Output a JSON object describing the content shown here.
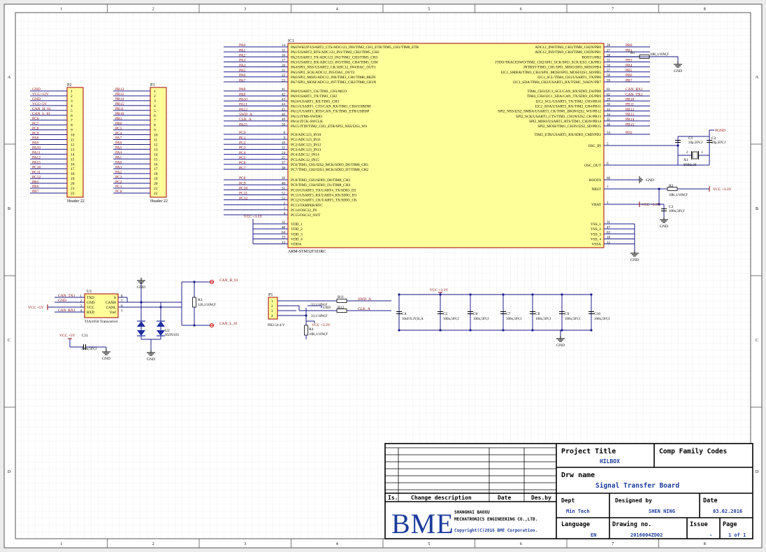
{
  "colors": {
    "wire": "#1c1c8c",
    "label": "#8b0000",
    "chipFill": "#ffff99",
    "chipBorder": "#a00000",
    "pin": "#8b0000",
    "grid": "#dcdcdc",
    "logo": "#1c3c9c",
    "sheetBg": "#ffffff"
  },
  "border": {
    "cols": [
      "1",
      "2",
      "3",
      "4",
      "5",
      "6",
      "7",
      "8"
    ],
    "rows": [
      "A",
      "B",
      "C",
      "D"
    ]
  },
  "p2": {
    "ref": "P2",
    "name": "Header 22",
    "nets": [
      "GND",
      "VCC+12V",
      "GND",
      "VCC+5V",
      "CAN_H_01",
      "CAN_L_01",
      "PC6",
      "PC7",
      "PC8",
      "PC9",
      "PA8",
      "PA9",
      "PA10",
      "PA11",
      "PA12",
      "PA15",
      "PC10",
      "PC11",
      "PC12",
      "PB5",
      "PB6",
      "PB7"
    ],
    "pins": [
      "1",
      "2",
      "3",
      "4",
      "5",
      "6",
      "7",
      "8",
      "9",
      "10",
      "11",
      "12",
      "13",
      "14",
      "15",
      "16",
      "17",
      "18",
      "19",
      "20",
      "21",
      "22"
    ]
  },
  "p3": {
    "ref": "P3",
    "name": "Header 22",
    "nets": [
      "PB13",
      "PB12",
      "PB14",
      "PB15",
      "PB11",
      "PB10",
      "PB1",
      "PB0",
      "PC5",
      "PC4",
      "PA7",
      "PA6",
      "PA5",
      "PA4",
      "PA1",
      "PA0",
      "PA3",
      "PA2",
      "PC3",
      "PC2",
      "PC1",
      "PC0"
    ],
    "pins": [
      "1",
      "2",
      "3",
      "4",
      "5",
      "6",
      "7",
      "8",
      "9",
      "10",
      "11",
      "12",
      "13",
      "14",
      "15",
      "16",
      "17",
      "18",
      "19",
      "20",
      "21",
      "22"
    ]
  },
  "ic1": {
    "ref": "IC1",
    "name": "ARM-STM32F103RC",
    "left1": [
      {
        "net": "PA0",
        "pin": "14",
        "fn": "PA0/WKUP/USART2_CTS/ADC123_IN0/TIM2_CH1_ETR/TIM5_CH1/TIM8_ETR"
      },
      {
        "net": "PA1",
        "pin": "15",
        "fn": "PA1/USART2_RTS/ADC123_IN1/TIM2_CH2/TIM5_CH2"
      },
      {
        "net": "PA2",
        "pin": "16",
        "fn": "PA2/USART2_TX/ADC123_IN2/TIM2_CH3/TIM5_CH3"
      },
      {
        "net": "PA3",
        "pin": "17",
        "fn": "PA3/USART2_RX/ADC123_IN3/TIM2_CH4/TIM5_CH4"
      },
      {
        "net": "PA4",
        "pin": "20",
        "fn": "PA4/SPI1_NSS/USART2_CK/ADC12_IN4/DAC_OUT1"
      },
      {
        "net": "PA5",
        "pin": "21",
        "fn": "PA5/SPI1_SCK/ADC12_IN5/DAC_OUT2"
      },
      {
        "net": "PA6",
        "pin": "22",
        "fn": "PA6/SPI1_MISO/ADC12_IN6/TIM3_CH1/TIM8_BKIN"
      },
      {
        "net": "PA7",
        "pin": "23",
        "fn": "PA7/SPI1_MOSI/ADC12_IN7/TIM3_CH2/TIM8_CH1N"
      }
    ],
    "left2": [
      {
        "net": "PA8",
        "pin": "41",
        "fn": "PA8/USART1_CK/TIM1_CH1/MCO"
      },
      {
        "net": "PA9",
        "pin": "42",
        "fn": "PA9/USART1_TX/TIM1_CH2"
      },
      {
        "net": "PA10",
        "pin": "43",
        "fn": "PA10/USART1_RX/TIM1_CH3"
      },
      {
        "net": "PA11",
        "pin": "44",
        "fn": "PA11/USART1_CTS/CAN_RX/TIM1_CH4/USBDM"
      },
      {
        "net": "PA12",
        "pin": "45",
        "fn": "PA12/USART1_RTS/CAN_TX/TIM1_ETR/USBDP"
      },
      {
        "net": "SWD_A",
        "pin": "46",
        "fn": "PA13/JTMS-SWDIO"
      },
      {
        "net": "CLK_A",
        "pin": "49",
        "fn": "PA14/JTCK-SWCLK"
      },
      {
        "net": "PA15",
        "pin": "50",
        "fn": "PA15/JTDI/TIM2_CH1_ETR/SPI3_NSS/I2S3_WS"
      }
    ],
    "left3": [
      {
        "net": "PC0",
        "pin": "8",
        "fn": "PC0/ADC123_IN10"
      },
      {
        "net": "PC1",
        "pin": "9",
        "fn": "PC1/ADC123_IN11"
      },
      {
        "net": "PC2",
        "pin": "10",
        "fn": "PC2/ADC123_IN12"
      },
      {
        "net": "PC3",
        "pin": "11",
        "fn": "PC3/ADC123_IN13"
      },
      {
        "net": "PC4",
        "pin": "24",
        "fn": "PC4/ADC12_IN14"
      },
      {
        "net": "PC5",
        "pin": "25",
        "fn": "PC5/ADC12_IN15"
      },
      {
        "net": "PC6",
        "pin": "37",
        "fn": "PC6/TIM3_CH1/I2S2_MCK/SDIO_D6/TIM8_CH1"
      },
      {
        "net": "PC7",
        "pin": "38",
        "fn": "PC7/TIM3_CH2/I2S3_MCK/SDIO_D7/TIM8_CH2"
      }
    ],
    "left4": [
      {
        "net": "PC8",
        "pin": "39",
        "fn": "PC8/TIM3_CH3/SDIO_D0/TIM8_CH3"
      },
      {
        "net": "PC9",
        "pin": "40",
        "fn": "PC9/TIM3_CH4/SDIO_D1/TIM8_CH4"
      },
      {
        "net": "PC10",
        "pin": "51",
        "fn": "PC10/USART3_TX/UART4_TX/SDIO_D2"
      },
      {
        "net": "PC11",
        "pin": "52",
        "fn": "PC11/USART3_RX/UART4_RX/SDIO_D3"
      },
      {
        "net": "PC12",
        "pin": "53",
        "fn": "PC12/USART3_CK/UART5_TX/SDIO_CK"
      },
      {
        "net": "",
        "pin": "2",
        "fn": "PC13/TAMPER/RTC"
      },
      {
        "net": "",
        "pin": "3",
        "fn": "PC14/OSC32_IN"
      },
      {
        "net": "",
        "pin": "4",
        "fn": "PC15/OSC32_OUT"
      }
    ],
    "left5": [
      {
        "pin": "32",
        "fn": "VDD_1"
      },
      {
        "pin": "48",
        "fn": "VDD_2"
      },
      {
        "pin": "64",
        "fn": "VDD_3"
      },
      {
        "pin": "19",
        "fn": "VDD_4"
      },
      {
        "pin": "13",
        "fn": "VDDA"
      }
    ],
    "vccLeft": "VCC +3.3V",
    "right1": [
      {
        "net": "PB0",
        "pin": "26",
        "fn": "ADC12_IN8/TIM3_CH3/TIM8_CH2N/PB0"
      },
      {
        "net": "PB1",
        "pin": "27",
        "fn": "ADC12_IN9/TIM3_CH4/TIM8_CH3N/PB1"
      },
      {
        "net": "",
        "pin": "28",
        "fn": "BOOT1/PB2"
      },
      {
        "net": "PB3",
        "pin": "55",
        "fn": "JTDO/TRACESWO/TIM2_CH2/SPI1_SCK/SPI3_SCK/I2S3_CK/PB3"
      },
      {
        "net": "PB4",
        "pin": "56",
        "fn": "JNTRST/TIM3_CH1/SPI1_MISO/SPI3_MISO/PB4"
      },
      {
        "net": "PB5",
        "pin": "57",
        "fn": "I2C1_SMBAI/TIM3_CH2/SPI1_MOSI/SPI3_MOSI/I2S3_SD/PB5"
      },
      {
        "net": "PB6",
        "pin": "58",
        "fn": "I2C1_SCL/TIM4_CH1/USART1_TX/PB6"
      },
      {
        "net": "PB7",
        "pin": "59",
        "fn": "I2C1_SDA/TIM4_CH2/USART1_RX/TSMC_NADV/PB7"
      }
    ],
    "right2": [
      {
        "net": "CAN_RX1",
        "pin": "61",
        "fn": "TIM4_CH3/I2C1_SCL/CAN_RX/SDIO_D4/PB8"
      },
      {
        "net": "CAN_TX1",
        "pin": "62",
        "fn": "TIM4_CH4/I2C1_SDA/CAN_TX/SDIO_D5/PB9"
      },
      {
        "net": "PB10",
        "pin": "29",
        "fn": "I2C2_SCL/USART3_TX/TIM2_CH3/PB10"
      },
      {
        "net": "PB11",
        "pin": "30",
        "fn": "I2C2_SDA/USART3_RX/TIM2_CH4/PB11"
      },
      {
        "net": "PB12",
        "pin": "33",
        "fn": "SPI2_NSS/I2S2_SMBA/USART3_CK/TIM1_BKIN/I2S2_WS/PB12"
      },
      {
        "net": "PB13",
        "pin": "34",
        "fn": "SPI2_SCK/USART3_CTS/TIM1_CH1N/I2S2_CK/PB13"
      },
      {
        "net": "PB14",
        "pin": "35",
        "fn": "SPI2_MISO/USART3_RTS/TIM1_CH2N/PB14"
      },
      {
        "net": "PB15",
        "pin": "36",
        "fn": "SPI2_MOSI/TIM1_CH3N/I2S2_SD/PB15"
      }
    ],
    "pd2": {
      "net": "PD2",
      "pin": "54",
      "fn": "TIM3_ETR/USART5_RX/SDIO_CMD/PD2"
    },
    "osc_in": {
      "pin": "5",
      "fn": "OSC_IN"
    },
    "osc_out": {
      "pin": "6",
      "fn": "OSC_OUT"
    },
    "boot0": {
      "pin": "60",
      "fn": "BOOT0"
    },
    "nrst": {
      "pin": "7",
      "fn": "NRST"
    },
    "vbat": {
      "pin": "1",
      "fn": "VBAT"
    },
    "vss": [
      {
        "pin": "31",
        "fn": "VSS_1"
      },
      {
        "pin": "47",
        "fn": "VSS_2"
      },
      {
        "pin": "63",
        "fn": "VSS_3"
      },
      {
        "pin": "18",
        "fn": "VSS_4"
      },
      {
        "pin": "12",
        "fn": "VSSA"
      }
    ]
  },
  "r1": {
    "ref": "R1",
    "val": "10K,1/10W,F"
  },
  "r2": {
    "ref": "R2",
    "val": "10K,1/10W,F"
  },
  "c1": {
    "ref": "C1",
    "val": "20p,50V,J"
  },
  "c2": {
    "ref": "C2",
    "val": "20p,50V,J"
  },
  "c3": {
    "ref": "C3",
    "val": "100n,50V,J"
  },
  "x1": {
    "ref": "X1",
    "val": "8MHz,M",
    "pin1": "1",
    "pin2": "2"
  },
  "vcc33": "VCC +3.3V",
  "gnd": "GND",
  "pgnd": "PGND",
  "u1": {
    "ref": "U1",
    "name": "TJA1050 Transceiver",
    "lpins": [
      "TXD",
      "GND",
      "VCC",
      "RXD"
    ],
    "rpins": [
      "S",
      "CANH",
      "CANL",
      "Vref"
    ],
    "lnums": [
      "1",
      "2",
      "3",
      "4"
    ],
    "rnums": [
      "8",
      "7",
      "6",
      "5"
    ],
    "nets": [
      "CAN_TX1",
      "GND",
      "",
      "CAN_RX1"
    ],
    "vcc": "VCC +5V"
  },
  "r3": {
    "ref": "R3",
    "val": "120,1/10W,F"
  },
  "u2": {
    "ref": "U2",
    "val": "NUP2105"
  },
  "can_h": "CAN_H_01",
  "can_l": "CAN_L_01",
  "c11": {
    "ref": "C11",
    "val": "100n,50V,J",
    "vcc": "VCC +5V"
  },
  "p1": {
    "ref": "P1",
    "name": "PH2.54-4-V",
    "pins": [
      "1",
      "2",
      "3",
      "4"
    ]
  },
  "r11": {
    "ref": "R11",
    "val": "33,1/10W,F"
  },
  "r12": {
    "ref": "R12",
    "val": "33,1/10W,F"
  },
  "r4": {
    "ref": "R4",
    "val": "10K,1/10W,F"
  },
  "swd": "SWD_A",
  "clk": "CLK_A",
  "caps": [
    {
      "ref": "C4",
      "val": "10uF/6.3V,K,A"
    },
    {
      "ref": "C5",
      "val": "100n,50V,J"
    },
    {
      "ref": "C6",
      "val": "100n,50V,J"
    },
    {
      "ref": "C7",
      "val": "100n,50V,J"
    },
    {
      "ref": "C8",
      "val": "100n,50V,J"
    },
    {
      "ref": "C9",
      "val": "100n,50V,J"
    },
    {
      "ref": "C10",
      "val": "100n,50V,J"
    }
  ],
  "title_block": {
    "project_title_label": "Project Title",
    "project_title": "HILBOX",
    "comp_family_label": "Comp Family Codes",
    "drw_name_label": "Drw name",
    "drw_name": "Signal Transfer Board",
    "is_label": "Is.",
    "change_label": "Change description",
    "date_col_label": "Date",
    "des_by_label": "Des.by",
    "dept_label": "Dept",
    "dept": "Min Tech",
    "designed_by_label": "Designed by",
    "designed_by": "SHEN NING",
    "date_label": "Date",
    "date": "03.02.2016",
    "language_label": "Language",
    "language": "EN",
    "drawing_no_label": "Drawing no.",
    "drawing_no": "2016004ZD02",
    "issue_label": "Issue",
    "issue": "-",
    "page_label": "Page",
    "page": "1 of 1",
    "logo": "BME",
    "company_cn": "SHANGHAI BAOXU",
    "company_en": "MECHATRONICS ENGINEERING CO.,LTD.",
    "copyright": "Copyright(C)2016 BME Corporation."
  }
}
